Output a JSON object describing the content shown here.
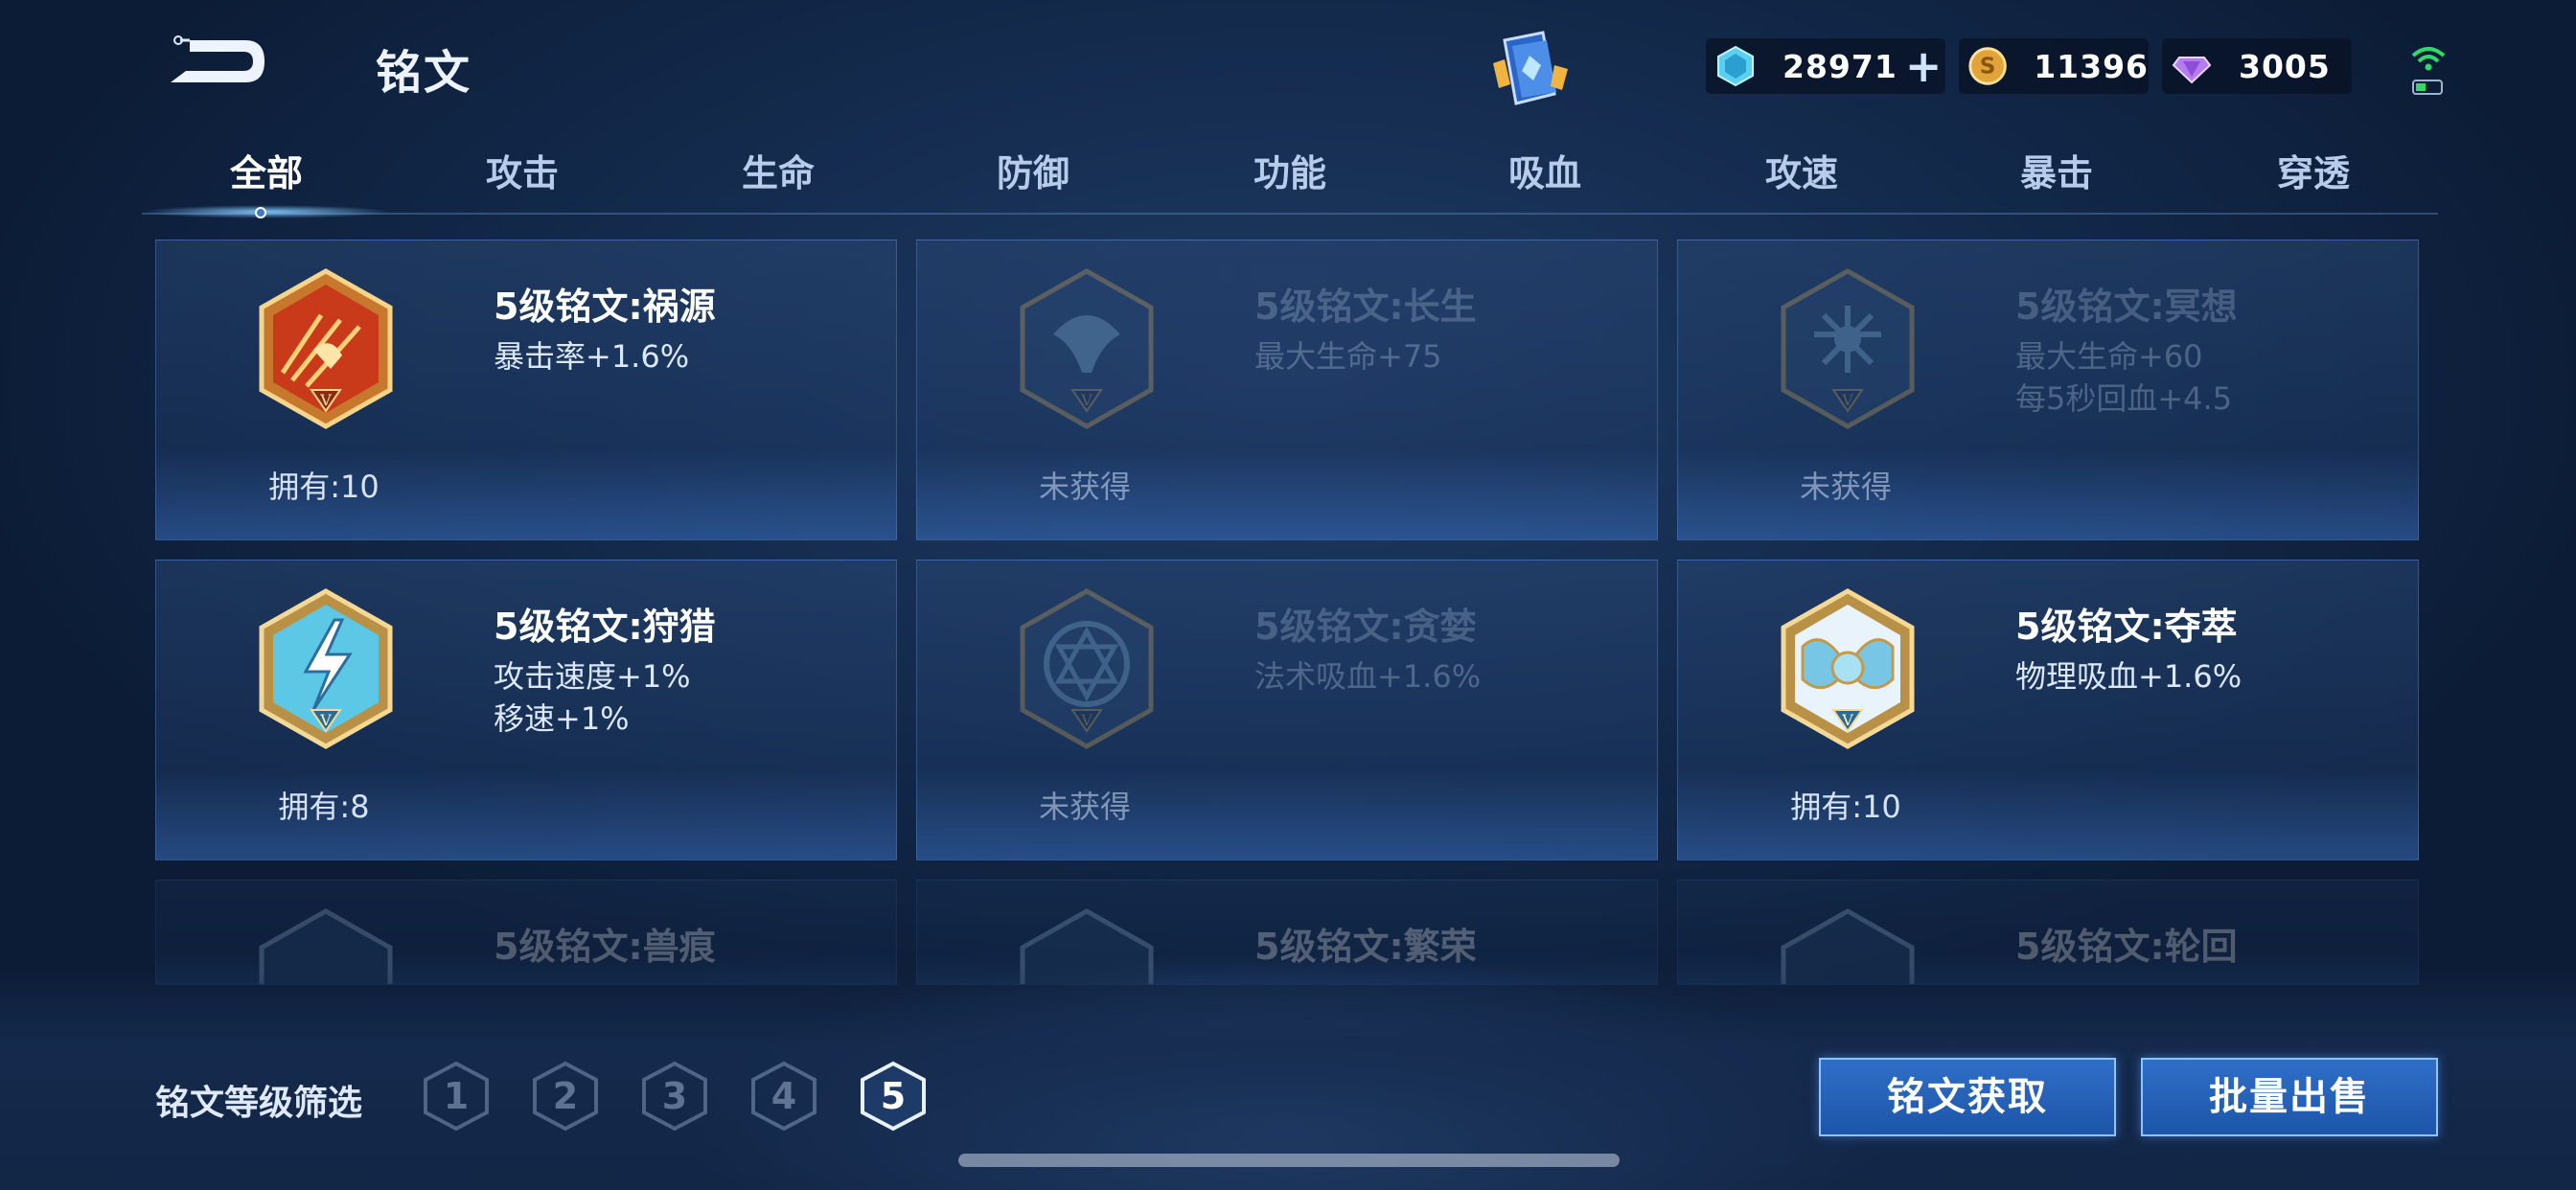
{
  "header": {
    "title": "铭文",
    "currencies": [
      {
        "icon": "jade-crystal-icon",
        "value": "28971"
      },
      {
        "icon": "gold-coin-icon",
        "value": "11396"
      },
      {
        "icon": "diamond-gem-icon",
        "value": "3005"
      }
    ],
    "add_symbol": "+"
  },
  "tabs": [
    "全部",
    "攻击",
    "生命",
    "防御",
    "功能",
    "吸血",
    "攻速",
    "暴击",
    "穿透"
  ],
  "active_tab": "全部",
  "cards": [
    {
      "name": "5级铭文:祸源",
      "stats": [
        "暴击率+1.6%"
      ],
      "owned": "拥有:10",
      "acquired": true,
      "emblem": "red-fire-rune-icon"
    },
    {
      "name": "5级铭文:长生",
      "stats": [
        "最大生命+75"
      ],
      "owned": "未获得",
      "acquired": false,
      "emblem": "tree-rune-icon"
    },
    {
      "name": "5级铭文:冥想",
      "stats": [
        "最大生命+60",
        "每5秒回血+4.5"
      ],
      "owned": "未获得",
      "acquired": false,
      "emblem": "meditation-rune-icon"
    },
    {
      "name": "5级铭文:狩猎",
      "stats": [
        "攻击速度+1%",
        "移速+1%"
      ],
      "owned": "拥有:8",
      "acquired": true,
      "emblem": "lightning-rune-icon"
    },
    {
      "name": "5级铭文:贪婪",
      "stats": [
        "法术吸血+1.6%"
      ],
      "owned": "未获得",
      "acquired": false,
      "emblem": "star-circle-rune-icon"
    },
    {
      "name": "5级铭文:夺萃",
      "stats": [
        "物理吸血+1.6%"
      ],
      "owned": "拥有:10",
      "acquired": true,
      "emblem": "petal-rune-icon"
    },
    {
      "name": "5级铭文:兽痕",
      "stats": [],
      "owned": "",
      "acquired": false,
      "emblem": "beast-rune-icon"
    },
    {
      "name": "5级铭文:繁荣",
      "stats": [],
      "owned": "",
      "acquired": false,
      "emblem": "prosper-rune-icon"
    },
    {
      "name": "5级铭文:轮回",
      "stats": [],
      "owned": "",
      "acquired": false,
      "emblem": "cycle-rune-icon"
    }
  ],
  "footer": {
    "filter_label": "铭文等级筛选",
    "levels": [
      "1",
      "2",
      "3",
      "4",
      "5"
    ],
    "selected_level": "5",
    "acquire_button": "铭文获取",
    "sell_button": "批量出售"
  },
  "colors": {
    "accent": "#2f6fc8",
    "background": "#132a4c"
  }
}
